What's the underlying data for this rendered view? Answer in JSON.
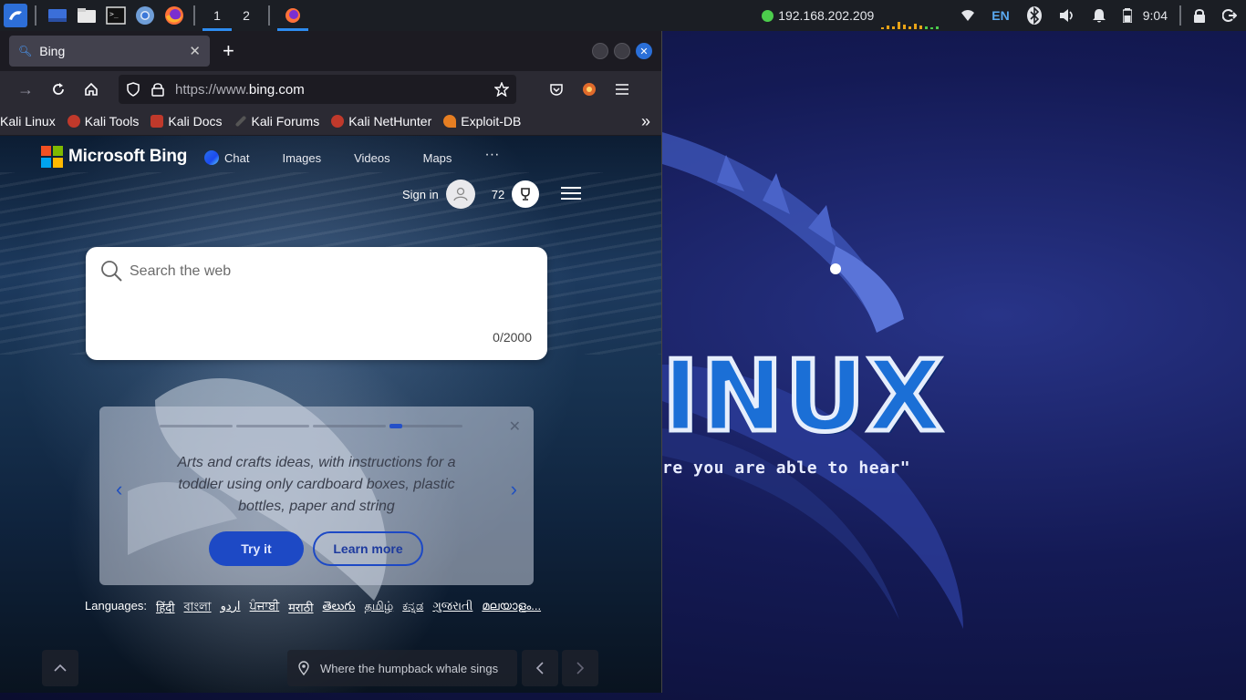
{
  "taskbar": {
    "workspaces": [
      "1",
      "2"
    ],
    "ip": "192.168.202.209",
    "lang": "EN",
    "time": "9:04"
  },
  "desktop": {
    "brand_partial": "INUX",
    "quote_partial": "re you are able to hear\""
  },
  "browser": {
    "tab_title": "Bing",
    "url_prefix": "https://www.",
    "url_domain": "bing.com",
    "bookmarks": [
      {
        "label": "Kali Linux",
        "color": "#2d8cf0"
      },
      {
        "label": "Kali Tools",
        "color": "#c0392b"
      },
      {
        "label": "Kali Docs",
        "color": "#c0392b"
      },
      {
        "label": "Kali Forums",
        "color": "#888888"
      },
      {
        "label": "Kali NetHunter",
        "color": "#c0392b"
      },
      {
        "label": "Exploit-DB",
        "color": "#e67e22"
      }
    ]
  },
  "bing": {
    "logo_text": "Microsoft Bing",
    "nav": [
      "Chat",
      "Images",
      "Videos",
      "Maps",
      "···"
    ],
    "sign_in": "Sign in",
    "points": "72",
    "search_placeholder": "Search the web",
    "char_count": "0/2000",
    "card_text": "Arts and crafts ideas, with instructions for a toddler using only cardboard boxes, plastic bottles, paper and string",
    "try_it": "Try it",
    "learn_more": "Learn more",
    "languages_label": "Languages:",
    "languages": [
      "हिंदी",
      "বাংলা",
      "اردو",
      "ਪੰਜਾਬੀ",
      "मराठी",
      "తెలుగు",
      "தமிழ்",
      "ಕನ್ನಡ",
      "ગુજરાતી",
      "മലയാളം..."
    ],
    "image_caption": "Where the humpback whale sings"
  },
  "colors": {
    "accent": "#2d8cf0",
    "bing_button": "#1d49c5",
    "panel_bg": "#1b1e24"
  }
}
